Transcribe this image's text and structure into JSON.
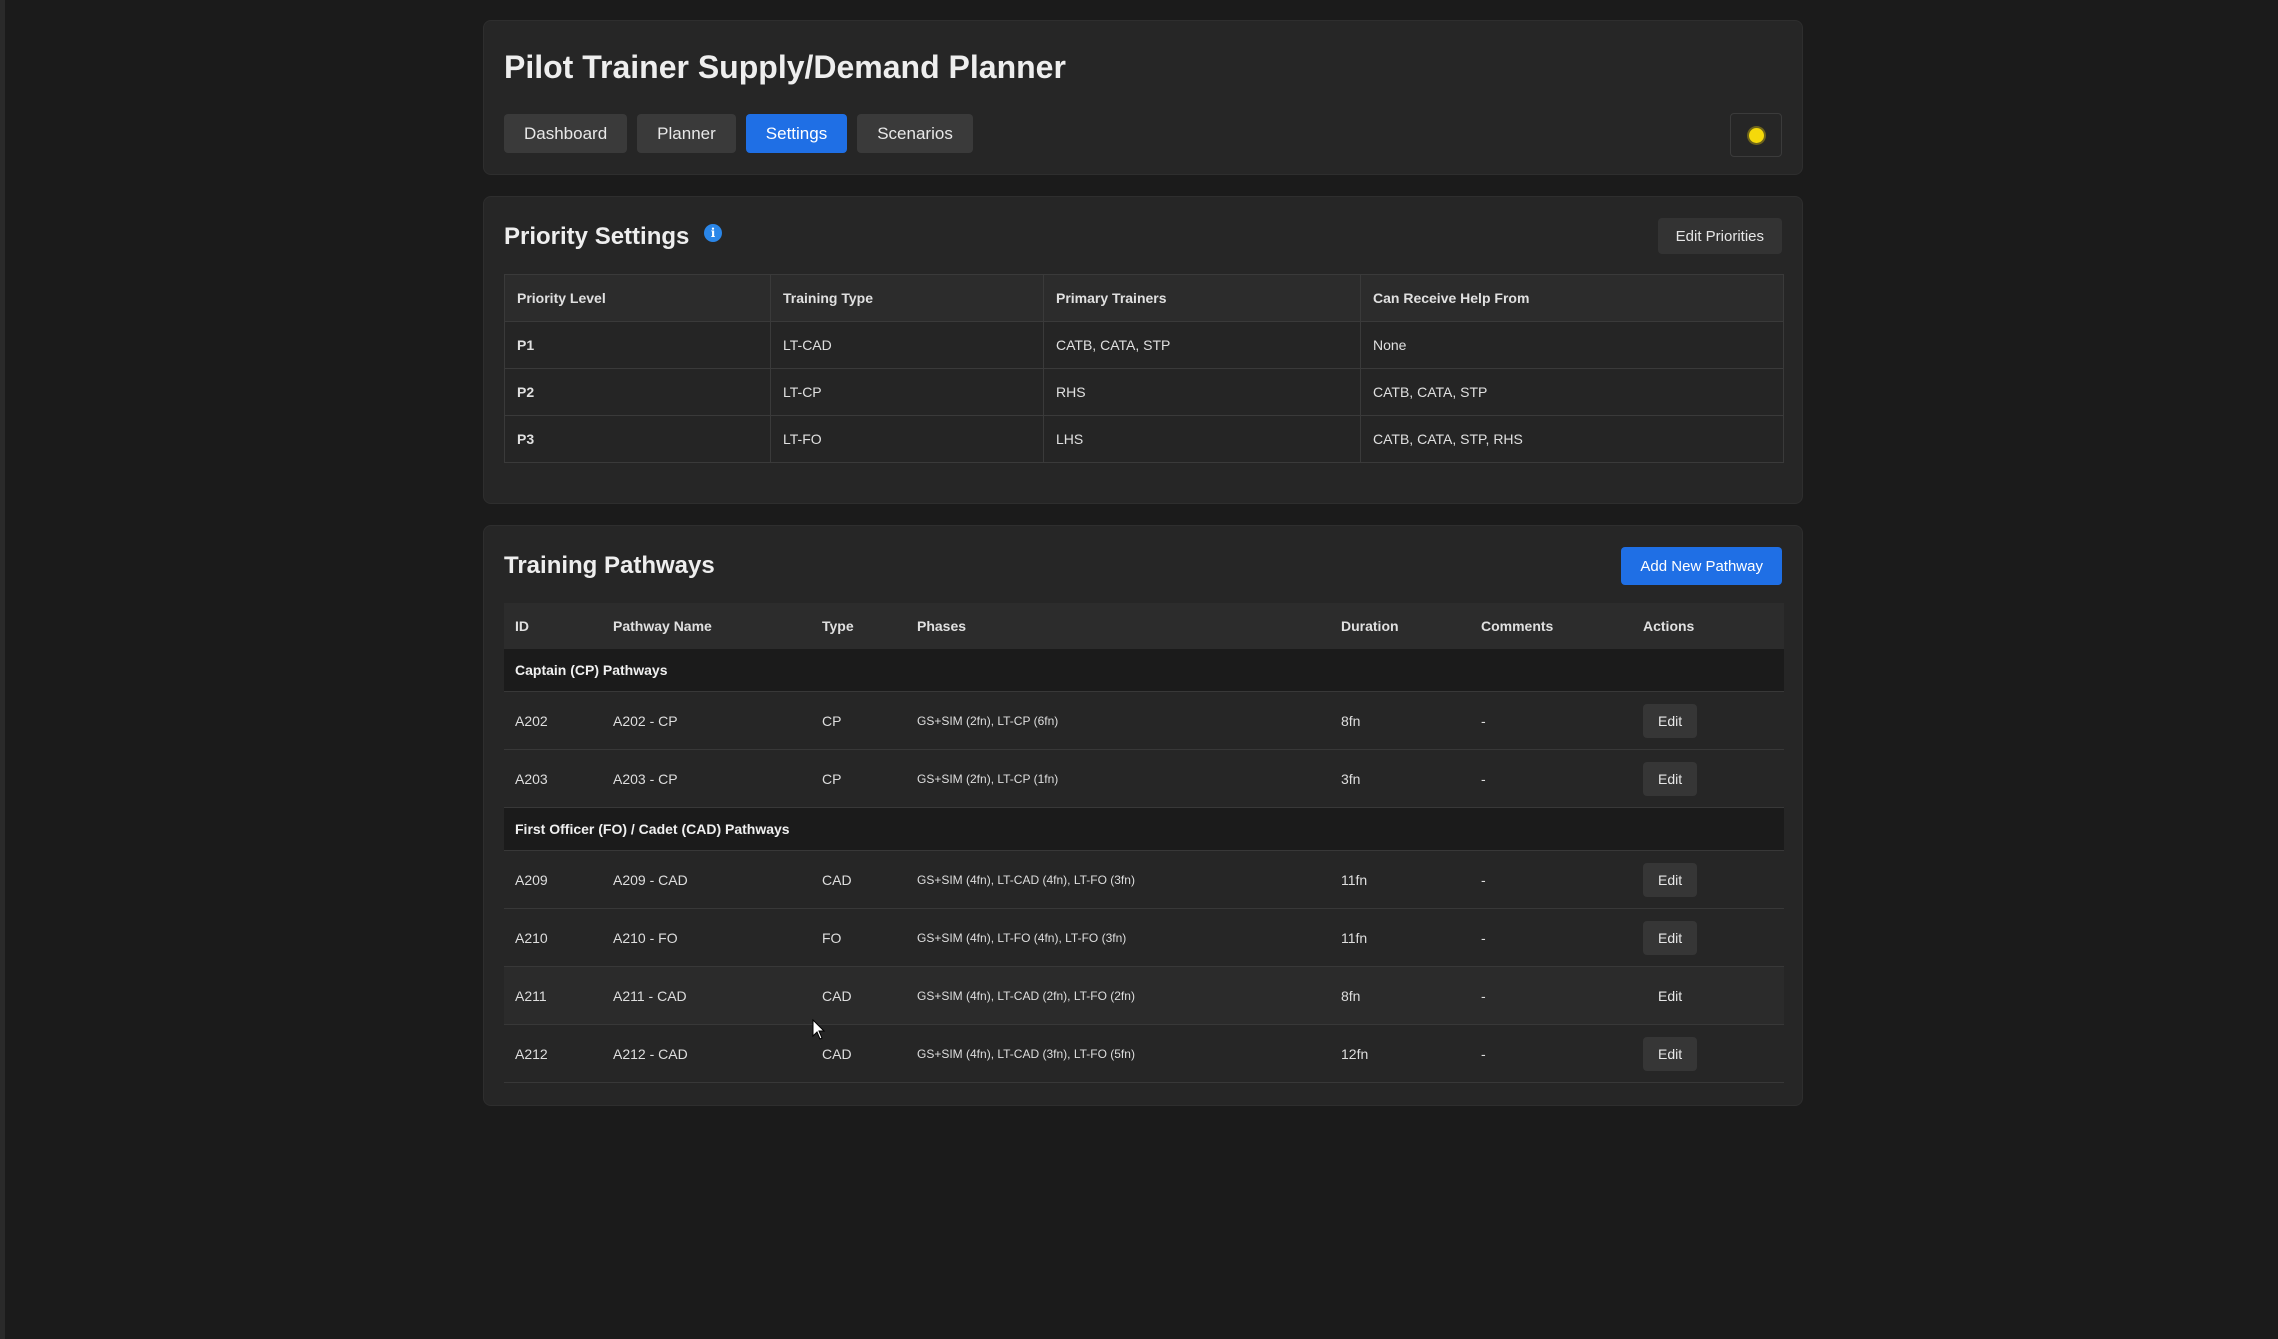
{
  "app": {
    "title": "Pilot Trainer Supply/Demand Planner"
  },
  "nav": {
    "tabs": [
      {
        "label": "Dashboard",
        "active": false
      },
      {
        "label": "Planner",
        "active": false
      },
      {
        "label": "Settings",
        "active": true
      },
      {
        "label": "Scenarios",
        "active": false
      }
    ],
    "theme_icon": "sun-icon"
  },
  "priority_settings": {
    "title": "Priority Settings",
    "info_icon": "info-icon",
    "info_glyph": "i",
    "edit_label": "Edit Priorities",
    "columns": [
      "Priority Level",
      "Training Type",
      "Primary Trainers",
      "Can Receive Help From"
    ],
    "rows": [
      [
        "P1",
        "LT-CAD",
        "CATB, CATA, STP",
        "None"
      ],
      [
        "P2",
        "LT-CP",
        "RHS",
        "CATB, CATA, STP"
      ],
      [
        "P3",
        "LT-FO",
        "LHS",
        "CATB, CATA, STP, RHS"
      ]
    ]
  },
  "training_pathways": {
    "title": "Training Pathways",
    "add_label": "Add New Pathway",
    "columns": [
      "ID",
      "Pathway Name",
      "Type",
      "Phases",
      "Duration",
      "Comments",
      "Actions"
    ],
    "groups": [
      {
        "label": "Captain (CP) Pathways",
        "rows": [
          {
            "id": "A202",
            "name": "A202 - CP",
            "type": "CP",
            "phases": "GS+SIM (2fn), LT-CP (6fn)",
            "duration": "8fn",
            "comments": "-",
            "action": "Edit"
          },
          {
            "id": "A203",
            "name": "A203 - CP",
            "type": "CP",
            "phases": "GS+SIM (2fn), LT-CP (1fn)",
            "duration": "3fn",
            "comments": "-",
            "action": "Edit"
          }
        ]
      },
      {
        "label": "First Officer (FO) / Cadet (CAD) Pathways",
        "rows": [
          {
            "id": "A209",
            "name": "A209 - CAD",
            "type": "CAD",
            "phases": "GS+SIM (4fn), LT-CAD (4fn), LT-FO (3fn)",
            "duration": "11fn",
            "comments": "-",
            "action": "Edit"
          },
          {
            "id": "A210",
            "name": "A210 - FO",
            "type": "FO",
            "phases": "GS+SIM (4fn), LT-FO (4fn), LT-FO (3fn)",
            "duration": "11fn",
            "comments": "-",
            "action": "Edit"
          },
          {
            "id": "A211",
            "name": "A211 - CAD",
            "type": "CAD",
            "phases": "GS+SIM (4fn), LT-CAD (2fn), LT-FO (2fn)",
            "duration": "8fn",
            "comments": "-",
            "action": "Edit"
          },
          {
            "id": "A212",
            "name": "A212 - CAD",
            "type": "CAD",
            "phases": "GS+SIM (4fn), LT-CAD (3fn), LT-FO (5fn)",
            "duration": "12fn",
            "comments": "-",
            "action": "Edit"
          }
        ]
      }
    ]
  },
  "colors": {
    "background": "#1b1b1b",
    "card": "#262626",
    "accent": "#1f6fe5",
    "sun": "#f5d90a"
  }
}
